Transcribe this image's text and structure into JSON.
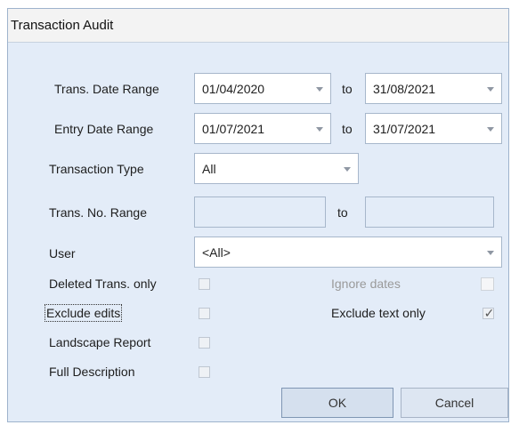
{
  "window": {
    "title": "Transaction Audit"
  },
  "rows": {
    "trans_date": {
      "label": "Trans. Date Range",
      "from": "01/04/2020",
      "to_label": "to",
      "to": "31/08/2021"
    },
    "entry_date": {
      "label": "Entry Date Range",
      "from": "01/07/2021",
      "to_label": "to",
      "to": "31/07/2021"
    },
    "trans_type": {
      "label": "Transaction Type",
      "value": "All"
    },
    "trans_no": {
      "label": "Trans. No. Range",
      "from": "",
      "to_label": "to",
      "to": ""
    },
    "user": {
      "label": "User",
      "value": "<All>"
    }
  },
  "options": {
    "deleted_only": {
      "label": "Deleted Trans. only",
      "checked": false
    },
    "exclude_edits": {
      "label": "Exclude edits",
      "checked": false
    },
    "landscape": {
      "label": "Landscape Report",
      "checked": false
    },
    "full_description": {
      "label": "Full Description",
      "checked": false
    },
    "ignore_dates": {
      "label": "Ignore dates",
      "checked": false,
      "enabled": false
    },
    "exclude_text_only": {
      "label": "Exclude text only",
      "checked": true,
      "mark": "✓"
    }
  },
  "buttons": {
    "ok": "OK",
    "cancel": "Cancel"
  }
}
